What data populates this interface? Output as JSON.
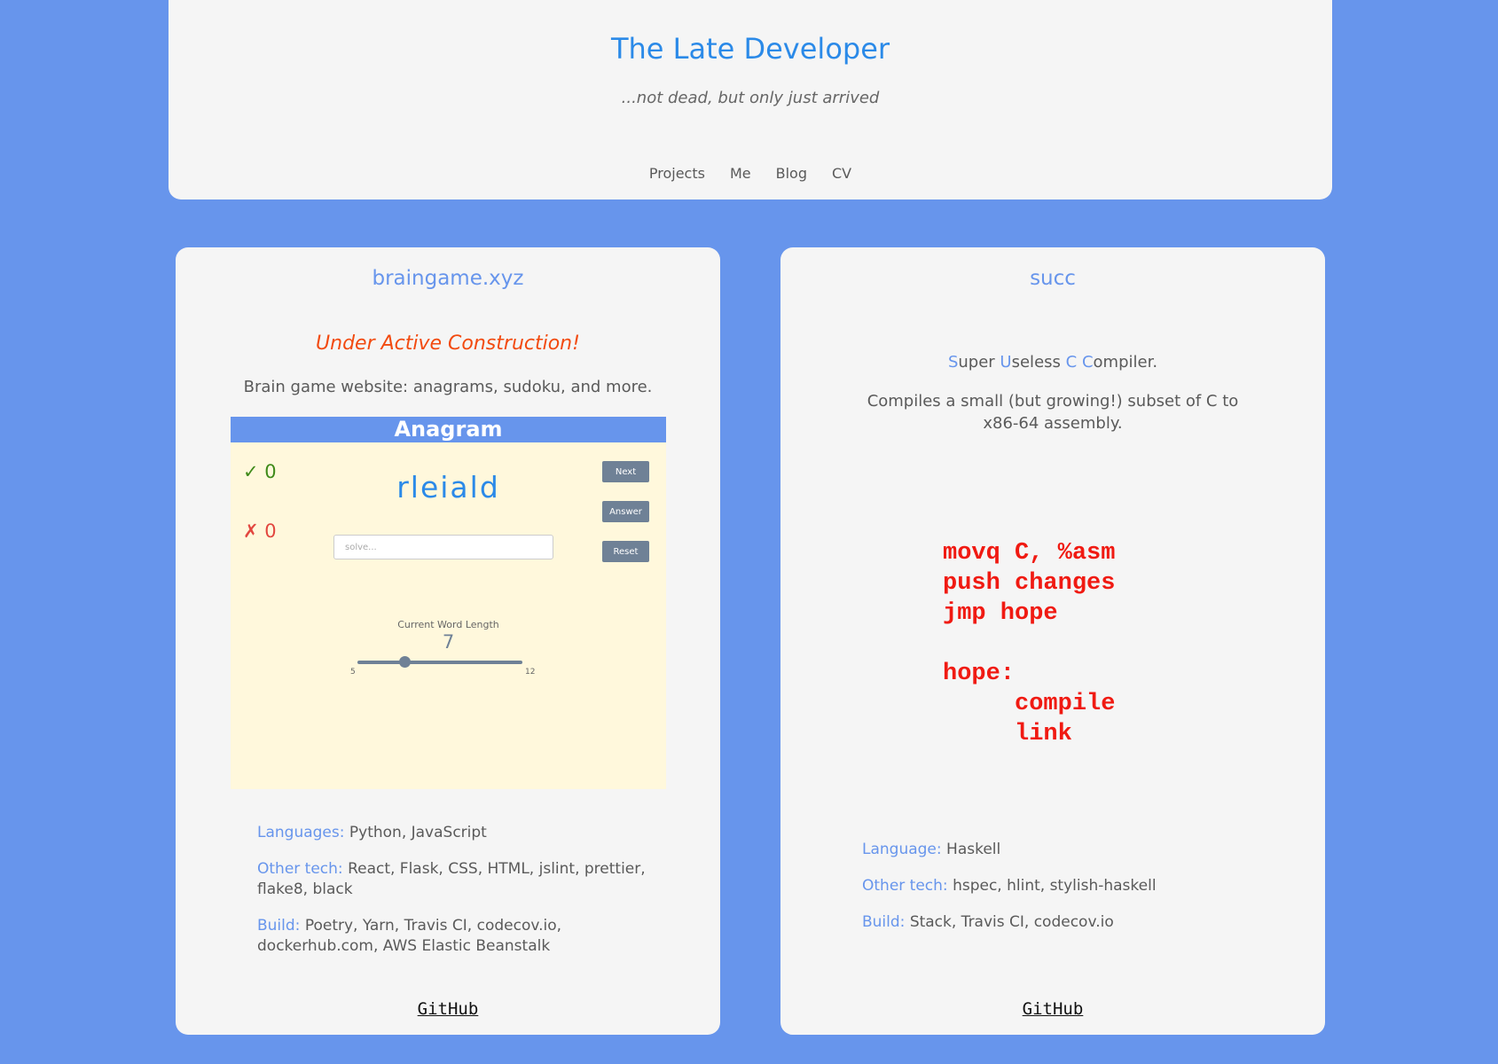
{
  "header": {
    "title": "The Late Developer",
    "tagline": "...not dead, but only just arrived",
    "nav": [
      "Projects",
      "Me",
      "Blog",
      "CV"
    ]
  },
  "cards": [
    {
      "title": "braingame.xyz",
      "notice": "Under Active Construction!",
      "description": "Brain game website: anagrams, sudoku, and more.",
      "preview": {
        "bar_title": "Anagram",
        "correct": "✓ 0",
        "wrong": "✗ 0",
        "word": "rleiald",
        "input_placeholder": "solve...",
        "buttons": [
          "Next",
          "Answer",
          "Reset"
        ],
        "length_label": "Current Word Length",
        "length_value": "7",
        "slider_min": "5",
        "slider_max": "12",
        "slider_value": 7
      },
      "tech": [
        {
          "label": "Languages:",
          "value": "Python, JavaScript"
        },
        {
          "label": "Other tech:",
          "value": "React, Flask, CSS, HTML, jslint, prettier, flake8, black"
        },
        {
          "label": "Build:",
          "value": "Poetry, Yarn, Travis CI, codecov.io, dockerhub.com, AWS Elastic Beanstalk"
        }
      ],
      "link": "GitHub"
    },
    {
      "title": "succ",
      "tagline_parts": [
        {
          "hl": "S",
          "rest": "uper "
        },
        {
          "hl": "U",
          "rest": "seless "
        },
        {
          "hl": "C",
          "rest": " "
        },
        {
          "hl": "C",
          "rest": "ompiler."
        }
      ],
      "description": "Compiles a small (but growing!) subset of C to x86-64 assembly.",
      "code": "movq C, %asm\npush changes\njmp hope\n\nhope:\n     compile\n     link",
      "tech": [
        {
          "label": "Language:",
          "value": "Haskell"
        },
        {
          "label": "Other tech:",
          "value": "hspec, hlint, stylish-haskell"
        },
        {
          "label": "Build:",
          "value": "Stack, Travis CI, codecov.io"
        }
      ],
      "link": "GitHub"
    }
  ]
}
